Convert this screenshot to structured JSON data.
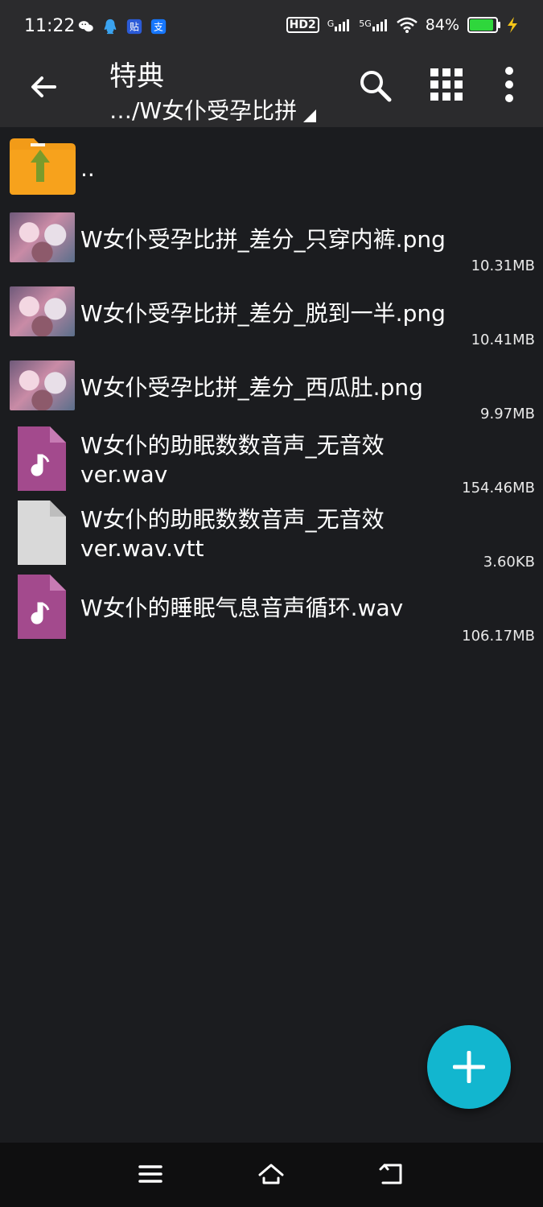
{
  "status": {
    "time": "11:22",
    "apps": [
      "wechat-icon",
      "qq-icon",
      "tieba-icon",
      "alipay-icon"
    ],
    "network_labels": [
      "HD2",
      "G",
      "5G"
    ],
    "battery_percent": "84%",
    "battery_level": 0.84,
    "battery_color": "#2fd63c"
  },
  "appbar": {
    "title": "特典",
    "path": "…/W女仆受孕比拼"
  },
  "files": [
    {
      "name": "..",
      "size": "",
      "type": "parent-folder"
    },
    {
      "name": "W女仆受孕比拼_差分_只穿内裤.png",
      "size": "10.31MB",
      "type": "image"
    },
    {
      "name": "W女仆受孕比拼_差分_脱到一半.png",
      "size": "10.41MB",
      "type": "image"
    },
    {
      "name": "W女仆受孕比拼_差分_西瓜肚.png",
      "size": "9.97MB",
      "type": "image"
    },
    {
      "name_line1": "W女仆的助眠数数音声_无音效",
      "name_line2": "ver.wav",
      "size": "154.46MB",
      "type": "audio"
    },
    {
      "name_line1": "W女仆的助眠数数音声_无音效",
      "name_line2": "ver.wav.vtt",
      "size": "3.60KB",
      "type": "file"
    },
    {
      "name": "W女仆的睡眠气息音声循环.wav",
      "size": "106.17MB",
      "type": "audio"
    }
  ],
  "colors": {
    "background": "#1b1c1f",
    "appbar": "#2b2b2d",
    "fab": "#12b6cf",
    "audio_icon": "#a34a8d",
    "folder": "#f29b18",
    "folder_arrow": "#7a9b2b"
  },
  "fab_icon": "plus-icon",
  "navbar": [
    "menu-icon",
    "home-icon",
    "back-icon"
  ]
}
